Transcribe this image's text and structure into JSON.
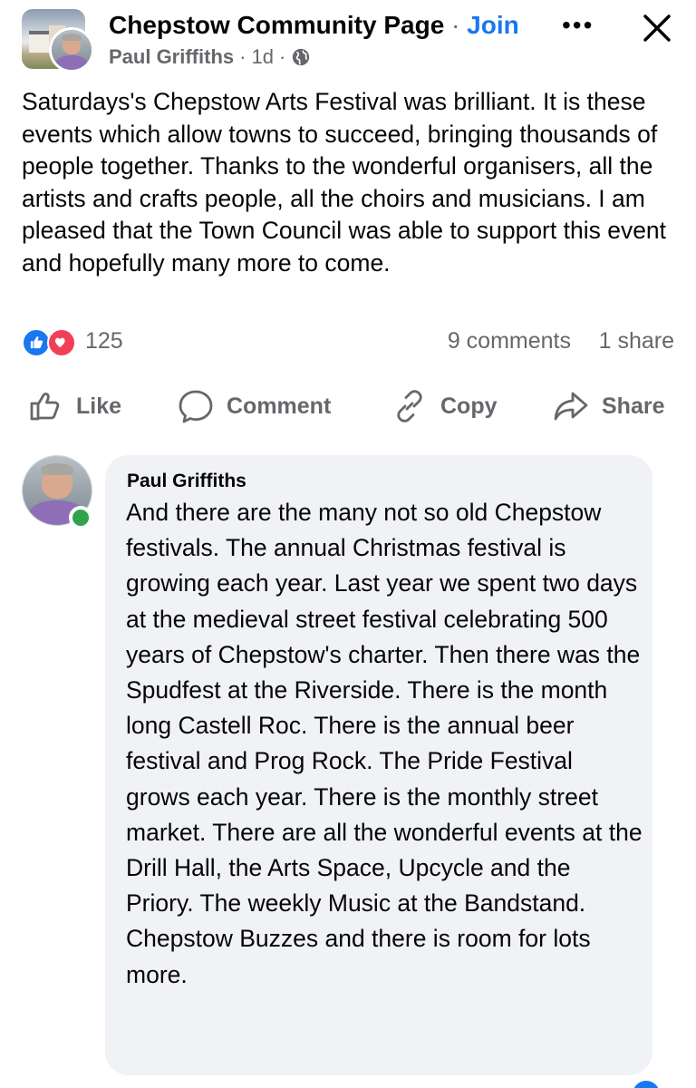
{
  "colors": {
    "accent": "#1877f2",
    "text_primary": "#050505",
    "text_secondary": "#65676b",
    "bubble_bg": "#f0f2f5",
    "online": "#31a24c",
    "love": "#f33e58"
  },
  "header": {
    "group_name": "Chepstow Community Page",
    "separator": "·",
    "join_label": "Join",
    "author": "Paul Griffiths",
    "time": "1d",
    "dot": "·",
    "privacy_icon": "globe-icon",
    "more_icon": "more-icon",
    "more_label": "•••",
    "close_icon": "close-icon"
  },
  "post": {
    "text": "Saturdays's Chepstow Arts Festival was brilliant. It is these events which allow towns to succeed, bringing thousands of people together. Thanks to the wonderful organisers, all the artists and crafts people, all the choirs and musicians. I am pleased that the Town Council was able to support this event and hopefully many more to come."
  },
  "stats": {
    "reaction_icons": [
      "like-reaction-icon",
      "love-reaction-icon"
    ],
    "reaction_count": "125",
    "comments": "9 comments",
    "shares": "1 share"
  },
  "actions": {
    "like": "Like",
    "comment": "Comment",
    "copy": "Copy",
    "share": "Share"
  },
  "comment": {
    "author": "Paul Griffiths",
    "text": "And there are the many not so old Chepstow festivals. The annual Christmas festival is growing each year. Last year we spent two days at the medieval street festival celebrating 500 years of Chepstow's charter. Then there was the Spudfest at the Riverside. There is the month long Castell Roc. There is the annual beer festival and Prog Rock. The Pride Festival grows each year. There is the monthly street market. There are all the wonderful events at the Drill Hall, the Arts Space, Upcycle and the Priory. The weekly Music at the Bandstand. Chepstow Buzzes and there is room for lots more."
  }
}
